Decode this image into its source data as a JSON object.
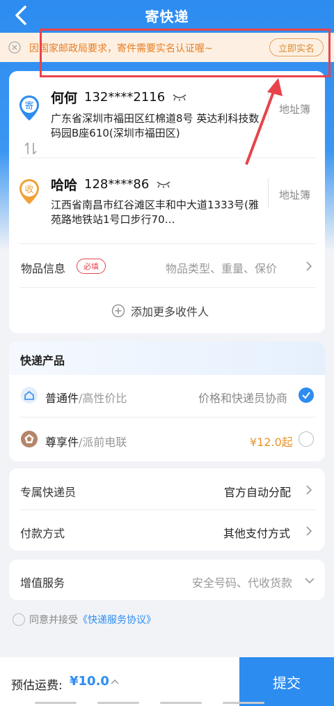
{
  "header": {
    "title": "寄快递"
  },
  "notice": {
    "text": "因国家邮政局要求，寄件需要实名认证喔~",
    "button": "立即实名"
  },
  "sender": {
    "icon_label": "寄",
    "name": "何何",
    "phone": "132****2116",
    "address": "广东省深圳市福田区红棉道8号 英达利科技数码园B座610(深圳市福田区)",
    "book_label": "地址簿"
  },
  "receiver": {
    "icon_label": "收",
    "name": "哈哈",
    "phone": "128****86",
    "address": "江西省南昌市红谷滩区丰和中大道1333号(雅苑路地铁站1号口步行70…",
    "book_label": "地址簿"
  },
  "goods": {
    "label": "物品信息",
    "badge": "必填",
    "hint": "物品类型、重量、保价"
  },
  "add_more": {
    "label": "添加更多收件人"
  },
  "products": {
    "title": "快递产品",
    "items": [
      {
        "name": "普通件",
        "sub": "/高性价比",
        "right": "价格和快递员协商",
        "selected": true,
        "icon": "house-icon"
      },
      {
        "name": "尊享件",
        "sub": "/派前电联",
        "right": "¥12.0起",
        "selected": false,
        "icon": "pentagon-icon"
      }
    ]
  },
  "options": [
    {
      "label": "专属快递员",
      "value": "官方自动分配"
    },
    {
      "label": "付款方式",
      "value": "其他支付方式"
    }
  ],
  "value_added": {
    "label": "增值服务",
    "value": "安全号码、代收货款"
  },
  "agreement": {
    "prefix": "同意并接受",
    "link": "《快递服务协议》"
  },
  "footer": {
    "fee_label": "预估运费:",
    "fee_value": "¥10.0",
    "submit": "提交"
  },
  "colors": {
    "primary": "#2d8cf0",
    "accent_orange": "#e8942c",
    "warning_red": "#e8434b",
    "notice_bg": "#fdf0e3"
  }
}
